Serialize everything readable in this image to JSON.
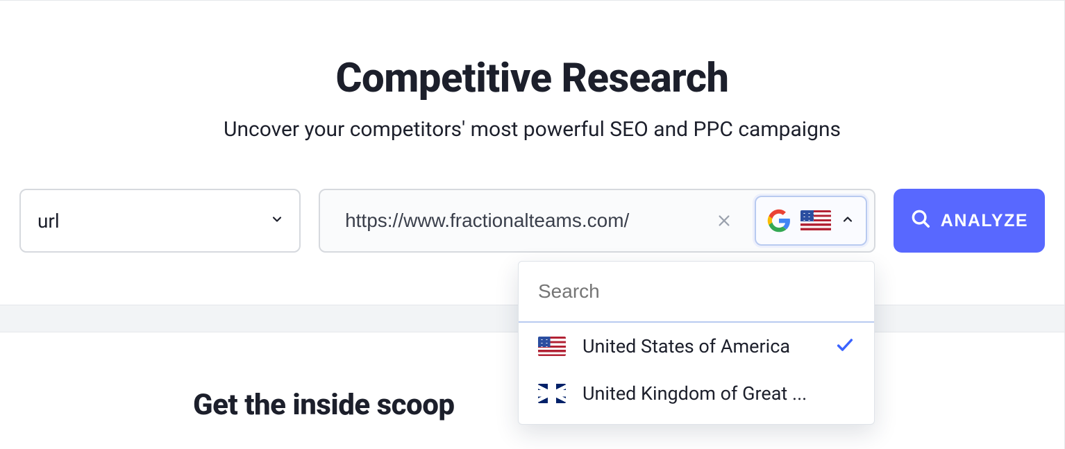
{
  "hero": {
    "title": "Competitive Research",
    "subtitle": "Uncover your competitors' most powerful SEO and PPC campaigns"
  },
  "search": {
    "type_label": "url",
    "url_value": "https://www.fractionalteams.com/",
    "analyze_label": "ANALYZE"
  },
  "region_dropdown": {
    "search_placeholder": "Search",
    "options": [
      {
        "label": "United States of America",
        "flag": "us",
        "selected": true
      },
      {
        "label": "United Kingdom of Great ...",
        "flag": "uk",
        "selected": false
      }
    ]
  },
  "below": {
    "inside_scoop": "Get the inside scoop"
  },
  "icons": {
    "google": "google-icon",
    "us_flag": "us-flag-icon",
    "uk_flag": "uk-flag-icon",
    "chevron_down": "chevron-down-icon",
    "chevron_up": "chevron-up-icon",
    "clear": "x-icon",
    "search": "search-icon",
    "check": "check-icon"
  },
  "colors": {
    "accent": "#5868ff",
    "text": "#1c1f2b",
    "border": "#d6d9de"
  }
}
